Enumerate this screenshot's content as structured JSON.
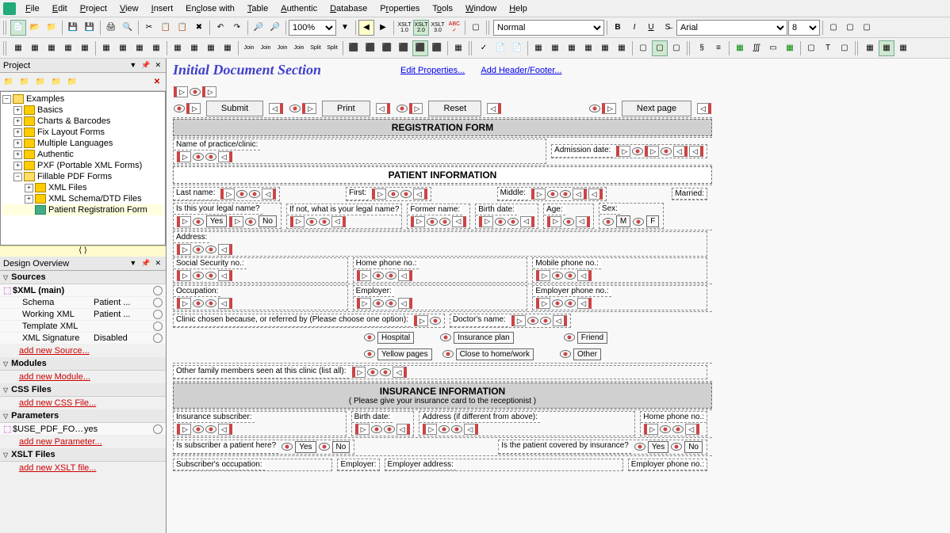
{
  "menu": [
    "File",
    "Edit",
    "Project",
    "View",
    "Insert",
    "Enclose with",
    "Table",
    "Authentic",
    "Database",
    "Properties",
    "Tools",
    "Window",
    "Help"
  ],
  "toolbar2": {
    "zoom": "100%",
    "style": "Normal",
    "font": "Arial",
    "size": "8"
  },
  "panel_project": {
    "title": "Project",
    "tree": {
      "root": "Examples",
      "items": [
        "Basics",
        "Charts & Barcodes",
        "Fix Layout Forms",
        "Multiple Languages",
        "Authentic",
        "PXF (Portable XML Forms)",
        "Fillable PDF Forms"
      ],
      "sub": [
        "XML Files",
        "XML Schema/DTD Files",
        "Patient Registration Form"
      ]
    }
  },
  "panel_overview": {
    "title": "Design Overview",
    "sources": {
      "header": "Sources",
      "xml_main": "$XML (main)",
      "schema_label": "Schema",
      "schema_val": "Patient ...",
      "working_label": "Working XML",
      "working_val": "Patient ...",
      "template_label": "Template XML",
      "template_val": "",
      "sig_label": "XML Signature",
      "sig_val": "Disabled",
      "add": "add new Source..."
    },
    "modules": {
      "header": "Modules",
      "add": "add new Module..."
    },
    "css": {
      "header": "CSS Files",
      "add": "add new CSS File..."
    },
    "params": {
      "header": "Parameters",
      "p1_label": "$USE_PDF_FORM",
      "p1_val": "yes",
      "add": "add new Parameter..."
    },
    "xslt": {
      "header": "XSLT Files",
      "add": "add new XSLT file..."
    }
  },
  "doc": {
    "title": "Initial Document Section",
    "link1": "Edit Properties...",
    "link2": "Add Header/Footer...",
    "btn_submit": "Submit",
    "btn_print": "Print",
    "btn_reset": "Reset",
    "btn_next": "Next page",
    "banner1": "REGISTRATION FORM",
    "banner2": "PATIENT INFORMATION",
    "banner3": "INSURANCE INFORMATION",
    "banner3_sub": "( Please give your insurance card to the receptionist )",
    "f_practice": "Name of practice/clinic:",
    "f_admission": "Admission date:",
    "f_last": "Last name:",
    "f_first": "First:",
    "f_middle": "Middle:",
    "f_married": "Married:",
    "f_legal": "Is this your legal name?",
    "f_legal2": "If not, what is your legal name?",
    "f_former": "Former name:",
    "f_birth": "Birth date:",
    "f_age": "Age:",
    "f_sex": "Sex:",
    "f_yes": "Yes",
    "f_no": "No",
    "f_m": "M",
    "f_f": "F",
    "f_address": "Address:",
    "f_ssn": "Social Security no.:",
    "f_homephone": "Home phone no.:",
    "f_mobile": "Mobile phone no.:",
    "f_occupation": "Occupation:",
    "f_employer": "Employer:",
    "f_empphone": "Employer phone no.:",
    "f_clinic_because": "Clinic chosen because, or referred by (Please choose one option):",
    "f_doctor": "Doctor's name:",
    "f_hospital": "Hospital",
    "f_insplan": "Insurance plan",
    "f_friend": "Friend",
    "f_yellow": "Yellow pages",
    "f_close": "Close to home/work",
    "f_other": "Other",
    "f_family": "Other family members seen at this clinic (list all):",
    "f_ins_sub": "Insurance subscriber:",
    "f_ins_birth": "Birth date:",
    "f_ins_addr": "Address (if different from above):",
    "f_ins_home": "Home phone no.:",
    "f_sub_patient": "Is subscriber a patient here?",
    "f_covered": "Is the patient covered by insurance?",
    "f_sub_occ": "Subscriber's occupation:",
    "f_sub_emp": "Employer:",
    "f_sub_empaddr": "Employer address:",
    "f_sub_empphone": "Employer phone no.:"
  }
}
